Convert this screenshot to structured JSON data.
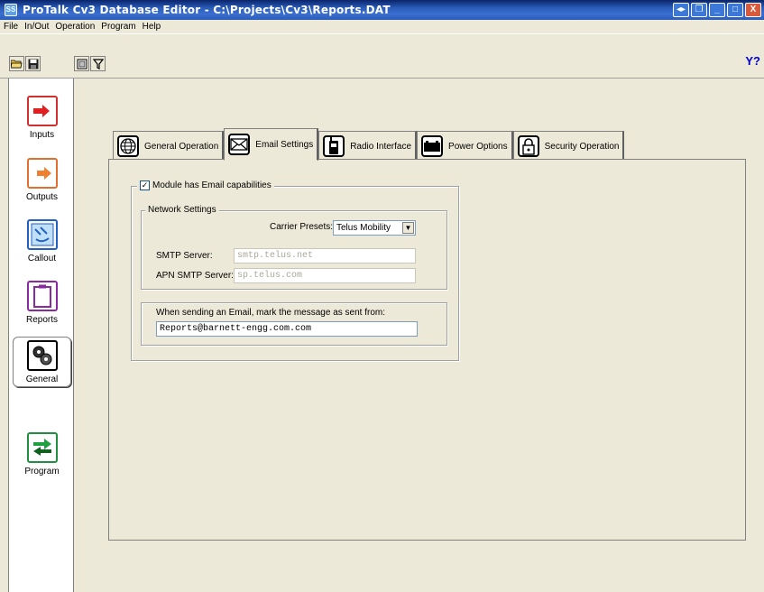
{
  "window": {
    "title": "ProTalk Cv3 Database Editor - C:\\Projects\\Cv3\\Reports.DAT",
    "app_icon_label": "SS",
    "controls": [
      "◂▸",
      "❐",
      "_",
      "□",
      "X"
    ]
  },
  "menu": [
    "File",
    "In/Out",
    "Operation",
    "Program",
    "Help"
  ],
  "toolbar": {
    "filter_help": "Y?"
  },
  "sidebar": {
    "items": [
      {
        "label": "Inputs"
      },
      {
        "label": "Outputs"
      },
      {
        "label": "Callout"
      },
      {
        "label": "Reports"
      },
      {
        "label": "General"
      },
      {
        "label": "Program"
      }
    ],
    "selected": "General"
  },
  "tabs": [
    {
      "label": "General Operation",
      "icon": "globe-icon"
    },
    {
      "label": "Email Settings",
      "icon": "envelope-icon"
    },
    {
      "label": "Radio Interface",
      "icon": "radio-icon"
    },
    {
      "label": "Power Options",
      "icon": "battery-icon"
    },
    {
      "label": "Security Operation",
      "icon": "lock-icon"
    }
  ],
  "active_tab": "Email Settings",
  "email": {
    "module_checkbox_label": "Module has Email capabilities",
    "module_checked": true,
    "network_settings_title": "Network Settings",
    "carrier_presets_label": "Carrier Presets:",
    "carrier_presets_value": "Telus Mobility",
    "smtp_label": "SMTP Server:",
    "smtp_value": "smtp.telus.net",
    "apn_label": "APN SMTP Server:",
    "apn_value": "sp.telus.com",
    "sent_from_label": "When sending an Email, mark the message as sent from:",
    "sent_from_value": "Reports@barnett-engg.com.com"
  }
}
